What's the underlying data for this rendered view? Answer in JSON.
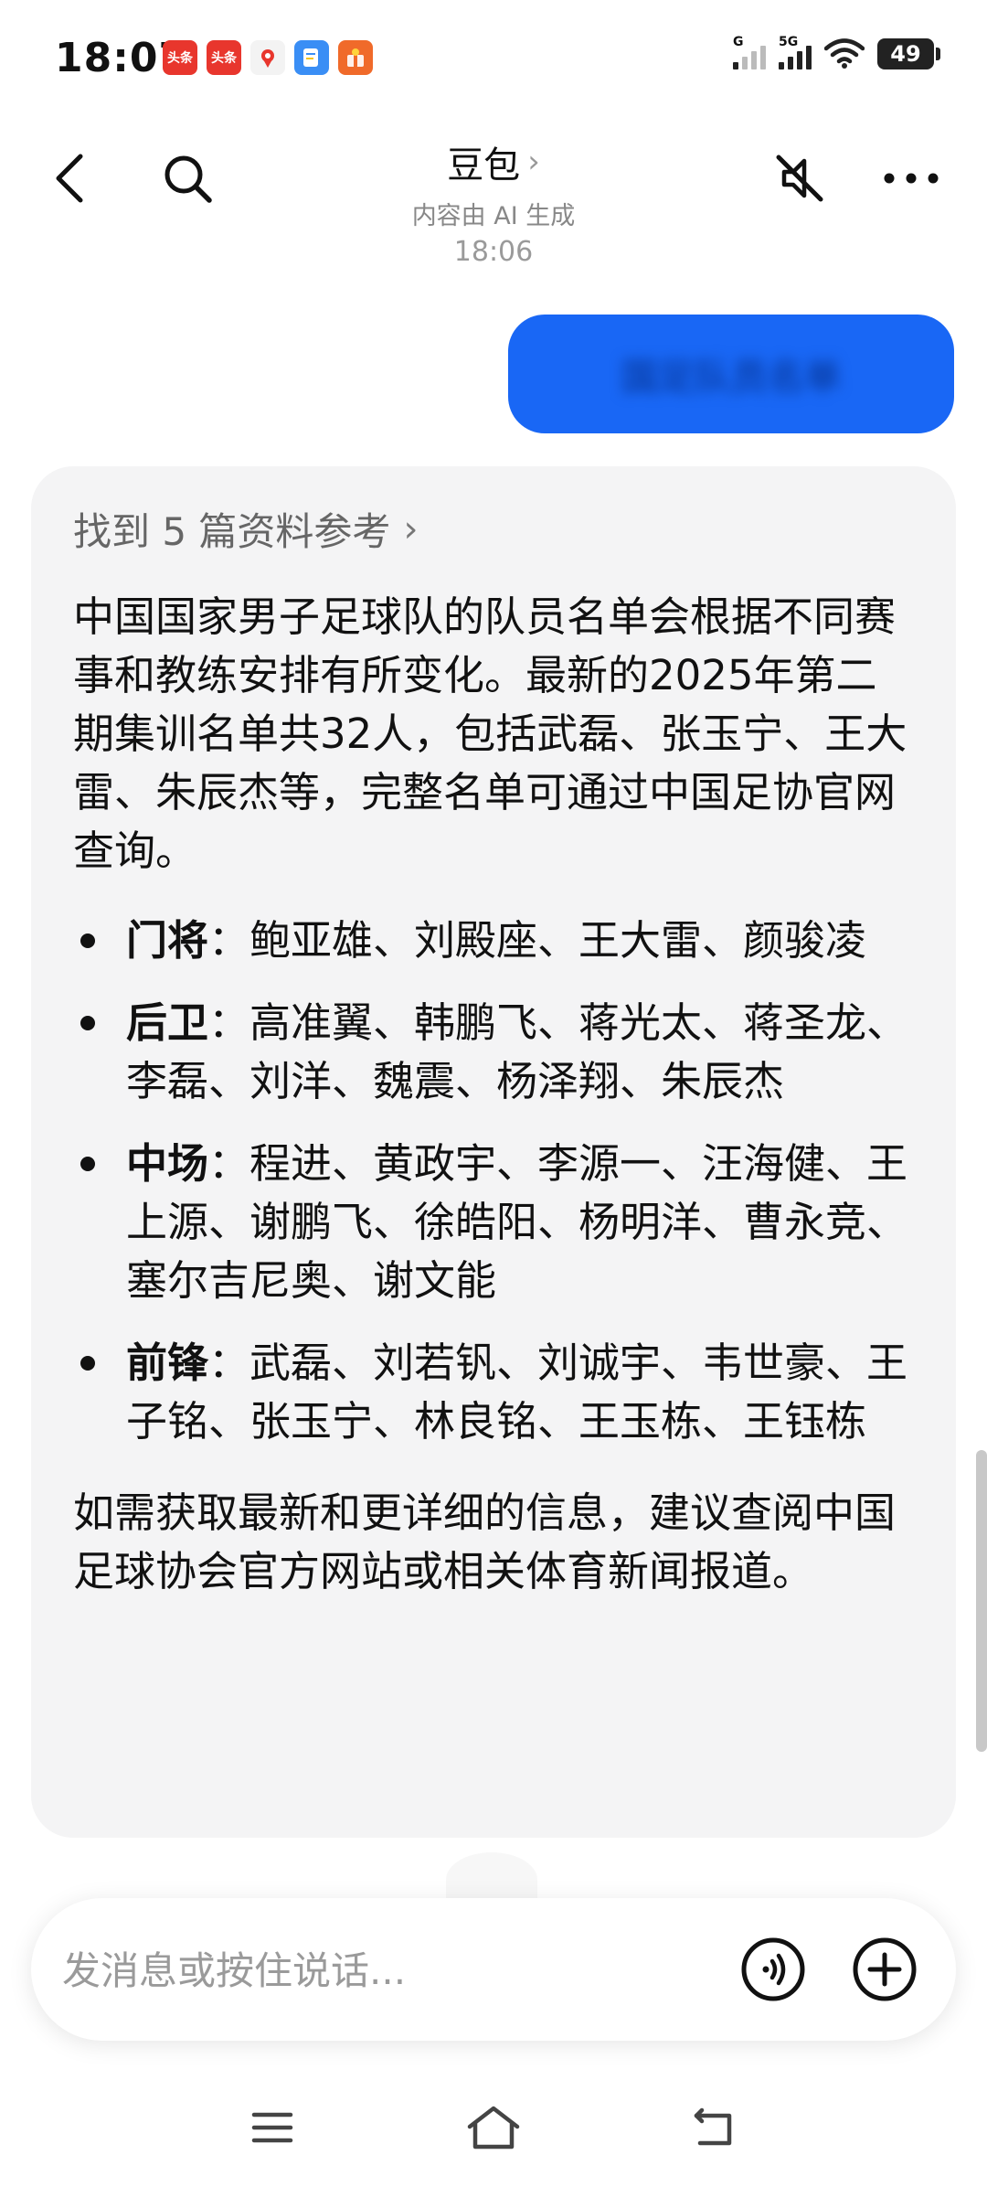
{
  "status_bar": {
    "time": "18:07",
    "notif_icons": [
      {
        "name": "toutiao-app-icon",
        "label": "头条",
        "color": "#e8362d"
      },
      {
        "name": "toutiao-app-icon-2",
        "label": "头条",
        "color": "#e8362d"
      },
      {
        "name": "map-app-icon",
        "label": "",
        "color": "#f3f3f3"
      },
      {
        "name": "doc-app-icon",
        "label": "",
        "color": "#3a8ef5"
      },
      {
        "name": "gift-app-icon",
        "label": "",
        "color": "#f06a2a"
      }
    ],
    "signal_1_tag": "G",
    "signal_2_tag": "5G",
    "battery": "49"
  },
  "header": {
    "title": "豆包",
    "subtitle": "内容由 AI 生成"
  },
  "chat": {
    "timestamp": "18:06",
    "user_message": "国足队员名单"
  },
  "ai_reply": {
    "refs_label": "找到 5 篇资料参考",
    "intro": "中国国家男子足球队的队员名单会根据不同赛事和教练安排有所变化。最新的2025年第二期集训名单共32人，包括武磊、张玉宁、王大雷、朱辰杰等，完整名单可通过中国足协官网查询。",
    "roster": [
      {
        "role": "门将",
        "players": "：鲍亚雄、刘殿座、王大雷、颜骏凌"
      },
      {
        "role": "后卫",
        "players": "：高准翼、韩鹏飞、蒋光太、蒋圣龙、李磊、刘洋、魏震、杨泽翔、朱辰杰"
      },
      {
        "role": "中场",
        "players": "：程进、黄政宇、李源一、汪海健、王上源、谢鹏飞、徐皓阳、杨明洋、曹永竞、塞尔吉尼奥、谢文能"
      },
      {
        "role": "前锋",
        "players": "：武磊、刘若钒、刘诚宇、韦世豪、王子铭、张玉宁、林良铭、王玉栋、王钰栋"
      }
    ],
    "closing": "如需获取最新和更详细的信息，建议查阅中国足球协会官方网站或相关体育新闻报道。"
  },
  "input": {
    "placeholder": "发消息或按住说话..."
  },
  "colors": {
    "accent": "#1967f5",
    "card_bg": "#f4f4f5"
  }
}
